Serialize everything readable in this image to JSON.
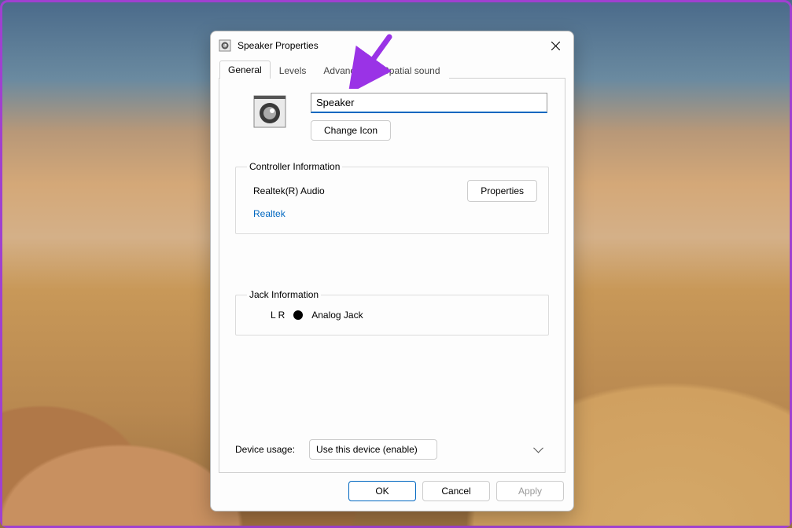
{
  "window": {
    "title": "Speaker Properties"
  },
  "tabs": [
    "General",
    "Levels",
    "Advanced",
    "Spatial sound"
  ],
  "activeTab": "General",
  "device": {
    "name": "Speaker",
    "changeIconLabel": "Change Icon"
  },
  "controller": {
    "legend": "Controller Information",
    "name": "Realtek(R) Audio",
    "vendor": "Realtek",
    "propertiesLabel": "Properties"
  },
  "jack": {
    "legend": "Jack Information",
    "lr": "L R",
    "label": "Analog Jack"
  },
  "usage": {
    "label": "Device usage:",
    "selected": "Use this device (enable)"
  },
  "buttons": {
    "ok": "OK",
    "cancel": "Cancel",
    "apply": "Apply"
  }
}
